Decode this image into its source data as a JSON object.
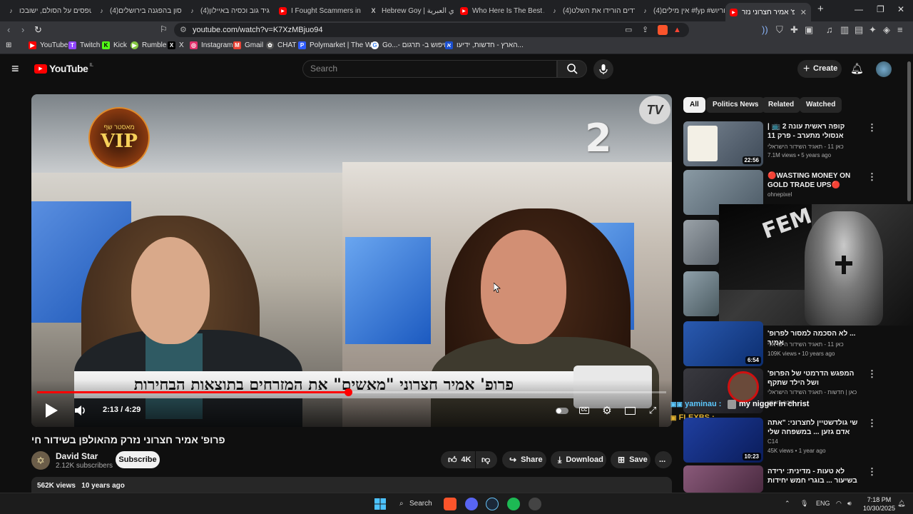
{
  "browser": {
    "tabs": [
      {
        "label": "מטפסים על הסולם, ישובכו",
        "icon": "tiktok-icon"
      },
      {
        "label": "(4)אסון בהפגנה בירושלים",
        "icon": "tiktok-icon"
      },
      {
        "label": "(4)גיד גוב וכסיה באיילון",
        "icon": "tiktok-icon"
      },
      {
        "label": "I Fought Scammers in Pari",
        "icon": "youtube-icon"
      },
      {
        "label": "Hebrew Goy | عوي العبرية",
        "icon": "x-icon"
      },
      {
        "label": "Who Here Is The Best At B",
        "icon": "youtube-icon"
      },
      {
        "label": "(4)חרדים הורידו את השלט",
        "icon": "tiktok-icon"
      },
      {
        "label": "(4)אין מילים #fyp #פוריוש",
        "icon": "tiktok-icon"
      },
      {
        "label": "פרופ' אמיר חצרוני נזר",
        "icon": "youtube-icon",
        "active": true
      }
    ],
    "new_tab": "+",
    "url": "youtube.com/watch?v=K7XzMBjuo94",
    "bookmarks": [
      {
        "label": "YouTube",
        "color": "#ff0000",
        "glyph": "▶"
      },
      {
        "label": "Twitch",
        "color": "#9146ff",
        "glyph": "T"
      },
      {
        "label": "Kick",
        "color": "#53fc18",
        "glyph": "K"
      },
      {
        "label": "Rumble",
        "color": "#85c742",
        "glyph": "▶"
      },
      {
        "label": "X",
        "color": "#000000",
        "glyph": "X"
      },
      {
        "label": "Instagram",
        "color": "#e1306c",
        "glyph": "◎"
      },
      {
        "label": "Gmail",
        "color": "#ea4335",
        "glyph": "M"
      },
      {
        "label": "CHAT",
        "color": "#555555",
        "glyph": "✿"
      },
      {
        "label": "Polymarket | The W...",
        "color": "#2e5cff",
        "glyph": "P"
      },
      {
        "label": "Go...- חיפוש ב- תרגום",
        "color": "#ffffff",
        "glyph": "G"
      },
      {
        "label": "הארץ - חדשות, ידיעו...",
        "color": "#1a4fd0",
        "glyph": "א"
      }
    ]
  },
  "youtube": {
    "logo": "YouTube",
    "logo_country": "IL",
    "search_placeholder": "Search",
    "create_label": "Create"
  },
  "player": {
    "time": "2:13 / 4:29",
    "progress": 0.494,
    "channel_number": "2",
    "vip_text": "VIP",
    "vip_subtext": "מאסטר שף",
    "tv_logo": "TV",
    "lower_third": "פרופ' אמיר חצרוני \"מאשים\" את המזרחים בתוצאות הבחירות"
  },
  "video": {
    "title": "פרופ' אמיר חצרוני נזרק מהאולפן בשידור חי",
    "channel": "David Star",
    "subscribers": "2.12K subscribers",
    "subscribe_label": "Subscribe",
    "likes": "4K",
    "share_label": "Share",
    "download_label": "Download",
    "save_label": "Save",
    "more_label": "...",
    "views": "562K views",
    "age": "10 years ago"
  },
  "sidebar": {
    "chips": [
      "All",
      "Politics News",
      "Related",
      "Watched"
    ],
    "recommendations": [
      {
        "title": "קופה ראשית עונה 2 📺 | אנסולי מתערב - פרק 11",
        "channel": "כאן 11 - תאגיד השידור הישראלי",
        "meta": "7.1M views • 5 years ago",
        "duration": "22:56",
        "thumb": "#5d6a78"
      },
      {
        "title": "🔴WASTING MONEY ON GOLD TRADE UPS🔴",
        "channel": "ohnepixel",
        "meta": "",
        "duration": "",
        "thumb": "#7b8891"
      },
      {
        "title": "",
        "channel": "",
        "meta": "",
        "duration": "",
        "thumb": "#58606a"
      },
      {
        "title": "",
        "channel": "",
        "meta": "",
        "duration": "",
        "thumb": "#6a7a84"
      },
      {
        "title": "... לא הסכמה למסור לפרופ' אמיר",
        "channel": "כאן 11 - תאגיד השידור הישראלי",
        "meta": "109K views • 10 years ago",
        "duration": "6:54",
        "thumb": "#2b5aa8"
      },
      {
        "title": "המפגש הדרמטי של הפרופ' ושל הילד שתקף",
        "channel": "כאן | חדשות - תאגיד השידור הישראלי",
        "meta": "years ago",
        "duration": "",
        "thumb": "#3a3a40"
      },
      {
        "title": "שי גולדשטיין לחצרוני: \"אתה אדם גזען ... במשפחה שלי עבדו כמו חמורים כדי",
        "channel": "C14",
        "meta": "45K views • 1 year ago",
        "duration": "10:23",
        "thumb": "#1f3fa0"
      },
      {
        "title": "לא טעות - מדינית: ירידה בשיעור ... בוגרי חמש יחידות במקצועות",
        "channel": "כאן | חדשות - תאגיד השידור הישראלי",
        "meta": "",
        "duration": "",
        "thumb": "#7a4a6a"
      }
    ],
    "overlay_text": "FEM",
    "chat": [
      {
        "user": "yaminau :",
        "message": "my nigger in christ",
        "user_color": "#5cc8ff"
      },
      {
        "user": "FLEXBS : ",
        "message": "",
        "user_color": "#e0b030"
      }
    ]
  },
  "taskbar": {
    "search_label": "Search",
    "language": "ENG",
    "time": "7:18 PM",
    "date": "10/30/2025"
  }
}
